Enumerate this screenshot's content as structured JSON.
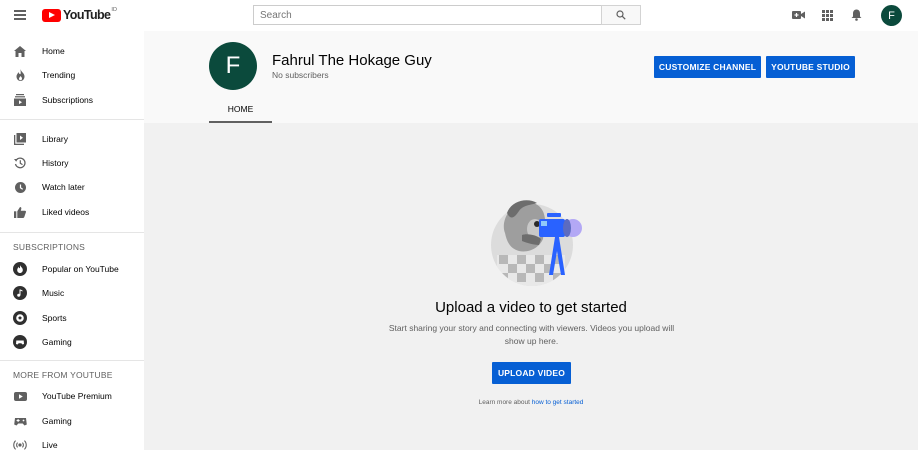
{
  "header": {
    "logo_text": "YouTube",
    "logo_cc": "ID",
    "search_placeholder": "Search",
    "avatar_letter": "F"
  },
  "sidebar": {
    "main_items": [
      {
        "label": "Home",
        "icon": "home-icon"
      },
      {
        "label": "Trending",
        "icon": "flame-icon"
      },
      {
        "label": "Subscriptions",
        "icon": "subscriptions-icon"
      }
    ],
    "library_items": [
      {
        "label": "Library",
        "icon": "library-icon"
      },
      {
        "label": "History",
        "icon": "history-icon"
      },
      {
        "label": "Watch later",
        "icon": "clock-icon"
      },
      {
        "label": "Liked videos",
        "icon": "thumbs-up-icon"
      }
    ],
    "subscriptions_heading": "SUBSCRIPTIONS",
    "subscriptions": [
      {
        "label": "Popular on YouTube",
        "icon": "popular-icon"
      },
      {
        "label": "Music",
        "icon": "music-icon"
      },
      {
        "label": "Sports",
        "icon": "sports-icon"
      },
      {
        "label": "Gaming",
        "icon": "gaming-icon"
      }
    ],
    "more_heading": "MORE FROM YOUTUBE",
    "more_items": [
      {
        "label": "YouTube Premium",
        "icon": "youtube-premium-icon"
      },
      {
        "label": "Gaming",
        "icon": "gaming-controller-icon"
      },
      {
        "label": "Live",
        "icon": "live-icon"
      }
    ]
  },
  "channel": {
    "avatar_letter": "F",
    "name": "Fahrul The Hokage Guy",
    "subscribers": "No subscribers",
    "customize_label": "CUSTOMIZE CHANNEL",
    "studio_label": "YOUTUBE STUDIO",
    "tabs": [
      {
        "label": "HOME",
        "active": true
      }
    ]
  },
  "empty_state": {
    "title": "Upload a video to get started",
    "description": "Start sharing your story and connecting with viewers. Videos you upload will show up here.",
    "upload_label": "UPLOAD VIDEO",
    "learn_prefix": "Learn more about",
    "learn_link": "how to get started"
  },
  "colors": {
    "brand_red": "#ff0000",
    "accent_blue": "#065fd4",
    "avatar_green": "#0b4a3c"
  }
}
